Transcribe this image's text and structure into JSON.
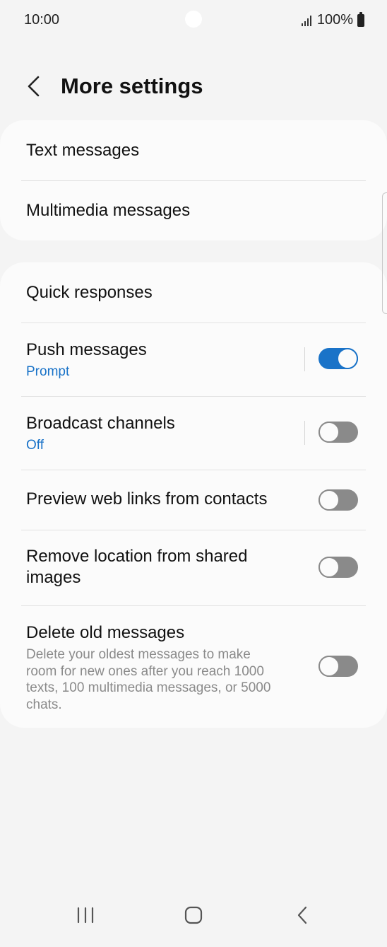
{
  "status_bar": {
    "time": "10:00",
    "battery_percent": "100%",
    "signal_icon": "signal-icon",
    "battery_icon": "battery-icon"
  },
  "header": {
    "back_icon": "chevron-left-icon",
    "title": "More settings"
  },
  "group1": {
    "items": [
      {
        "title": "Text messages"
      },
      {
        "title": "Multimedia messages"
      }
    ]
  },
  "group2": {
    "quick_responses": {
      "title": "Quick responses"
    },
    "push_messages": {
      "title": "Push messages",
      "subtitle": "Prompt",
      "enabled": true
    },
    "broadcast_channels": {
      "title": "Broadcast channels",
      "subtitle": "Off",
      "enabled": false
    },
    "preview_web_links": {
      "title": "Preview web links from contacts",
      "enabled": false
    },
    "remove_location": {
      "title_line1": "Remove location from shared",
      "title_line2": "images",
      "enabled": false
    },
    "delete_old_messages": {
      "title": "Delete old messages",
      "desc_line1": "Delete your oldest messages to make",
      "desc_line2": "room for new ones after you reach 1000",
      "desc_line3": "texts, 100 multimedia messages, or 5000",
      "desc_line4": "chats.",
      "enabled": false
    }
  },
  "nav_bar": {
    "recents_icon": "recents-icon",
    "home_icon": "home-icon",
    "back_icon": "back-icon"
  },
  "colors": {
    "accent": "#1a73c8",
    "background": "#f4f4f4",
    "card": "#fbfbfb",
    "toggle_off": "#8a8a8a"
  }
}
